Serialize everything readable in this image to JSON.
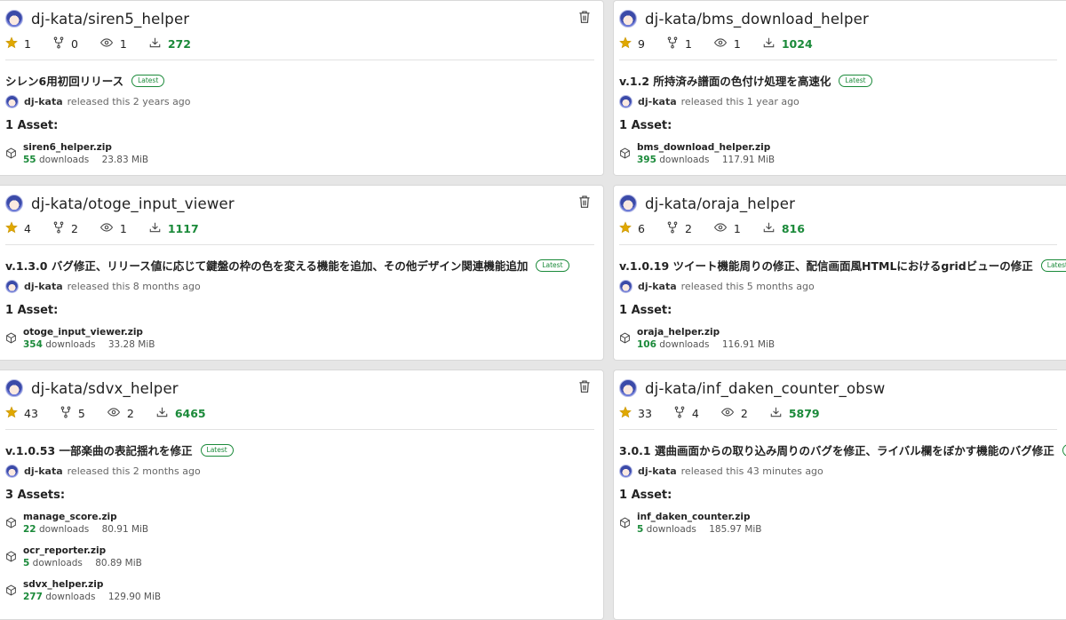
{
  "cards": [
    {
      "repo": "dj-kata/siren5_helper",
      "stars": "1",
      "forks": "0",
      "watchers": "1",
      "downloads": "272",
      "release_title": "シレン6用初回リリース",
      "badge": "Latest",
      "author": "dj-kata",
      "released": "released this 2 years ago",
      "assets_heading": "1 Asset:",
      "assets": [
        {
          "name": "siren6_helper.zip",
          "downloads": "55",
          "downloads_label": "downloads",
          "size": "23.83 MiB"
        }
      ],
      "has_trash": true
    },
    {
      "repo": "dj-kata/bms_download_helper",
      "stars": "9",
      "forks": "1",
      "watchers": "1",
      "downloads": "1024",
      "release_title": "v.1.2 所持済み譜面の色付け処理を高速化",
      "badge": "Latest",
      "author": "dj-kata",
      "released": "released this 1 year ago",
      "assets_heading": "1 Asset:",
      "assets": [
        {
          "name": "bms_download_helper.zip",
          "downloads": "395",
          "downloads_label": "downloads",
          "size": "117.91 MiB"
        }
      ],
      "has_trash": false
    },
    {
      "repo": "dj-kata/otoge_input_viewer",
      "stars": "4",
      "forks": "2",
      "watchers": "1",
      "downloads": "1117",
      "release_title": "v.1.3.0 バグ修正、リリース値に応じて鍵盤の枠の色を変える機能を追加、その他デザイン関連機能追加",
      "badge": "Latest",
      "author": "dj-kata",
      "released": "released this 8 months ago",
      "assets_heading": "1 Asset:",
      "assets": [
        {
          "name": "otoge_input_viewer.zip",
          "downloads": "354",
          "downloads_label": "downloads",
          "size": "33.28 MiB"
        }
      ],
      "has_trash": true
    },
    {
      "repo": "dj-kata/oraja_helper",
      "stars": "6",
      "forks": "2",
      "watchers": "1",
      "downloads": "816",
      "release_title": "v.1.0.19 ツイート機能周りの修正、配信画面風HTMLにおけるgridビューの修正",
      "badge": "Latest",
      "author": "dj-kata",
      "released": "released this 5 months ago",
      "assets_heading": "1 Asset:",
      "assets": [
        {
          "name": "oraja_helper.zip",
          "downloads": "106",
          "downloads_label": "downloads",
          "size": "116.91 MiB"
        }
      ],
      "has_trash": false
    },
    {
      "repo": "dj-kata/sdvx_helper",
      "stars": "43",
      "forks": "5",
      "watchers": "2",
      "downloads": "6465",
      "release_title": "v.1.0.53 一部楽曲の表記揺れを修正",
      "badge": "Latest",
      "author": "dj-kata",
      "released": "released this 2 months ago",
      "assets_heading": "3 Assets:",
      "assets": [
        {
          "name": "manage_score.zip",
          "downloads": "22",
          "downloads_label": "downloads",
          "size": "80.91 MiB"
        },
        {
          "name": "ocr_reporter.zip",
          "downloads": "5",
          "downloads_label": "downloads",
          "size": "80.89 MiB"
        },
        {
          "name": "sdvx_helper.zip",
          "downloads": "277",
          "downloads_label": "downloads",
          "size": "129.90 MiB"
        }
      ],
      "has_trash": true
    },
    {
      "repo": "dj-kata/inf_daken_counter_obsw",
      "stars": "33",
      "forks": "4",
      "watchers": "2",
      "downloads": "5879",
      "release_title": "3.0.1 選曲画面からの取り込み周りのバグを修正、ライバル欄をぼかす機能のバグ修正",
      "badge": "Latest",
      "author": "dj-kata",
      "released": "released this 43 minutes ago",
      "assets_heading": "1 Asset:",
      "assets": [
        {
          "name": "inf_daken_counter.zip",
          "downloads": "5",
          "downloads_label": "downloads",
          "size": "185.97 MiB"
        }
      ],
      "has_trash": false
    }
  ],
  "colors": {
    "accent_green": "#1b8a3a",
    "star": "#e0a800"
  }
}
